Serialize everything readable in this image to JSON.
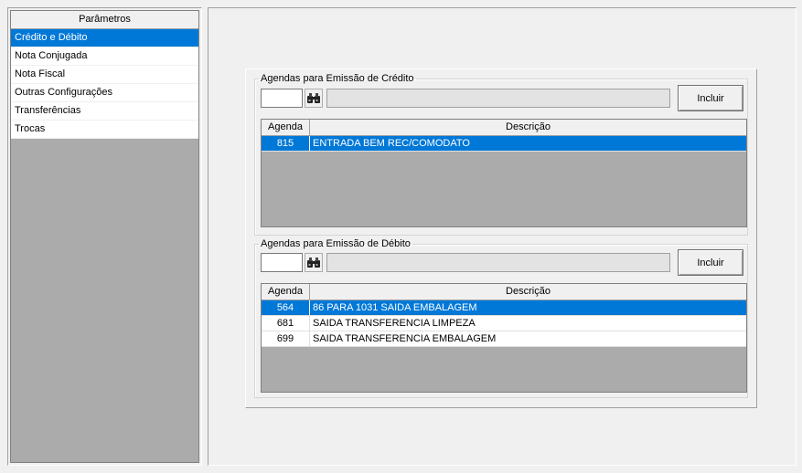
{
  "sidebar": {
    "header": "Parâmetros",
    "items": [
      {
        "label": "Crédito e Débito",
        "selected": true
      },
      {
        "label": "Nota Conjugada",
        "selected": false
      },
      {
        "label": "Nota Fiscal",
        "selected": false
      },
      {
        "label": "Outras Configurações",
        "selected": false
      },
      {
        "label": "Transferências",
        "selected": false
      },
      {
        "label": "Trocas",
        "selected": false
      }
    ]
  },
  "credit": {
    "legend": "Agendas para Emissão de Crédito",
    "code_value": "",
    "description_value": "",
    "include_label": "Incluir",
    "columns": {
      "agenda": "Agenda",
      "descricao": "Descrição"
    },
    "rows": [
      {
        "agenda": "815",
        "descricao": "ENTRADA BEM REC/COMODATO",
        "selected": true
      }
    ]
  },
  "debit": {
    "legend": "Agendas para Emissão de Débito",
    "code_value": "",
    "description_value": "",
    "include_label": "Incluir",
    "columns": {
      "agenda": "Agenda",
      "descricao": "Descrição"
    },
    "rows": [
      {
        "agenda": "564",
        "descricao": "86 PARA 1031 SAIDA EMBALAGEM",
        "selected": true
      },
      {
        "agenda": "681",
        "descricao": "SAIDA TRANSFERENCIA LIMPEZA",
        "selected": false
      },
      {
        "agenda": "699",
        "descricao": "SAIDA TRANSFERENCIA EMBALAGEM",
        "selected": false
      }
    ]
  },
  "icons": {
    "search": "binoculars-icon"
  },
  "colors": {
    "selection": "#0078d7",
    "grid_empty": "#ababab",
    "window_bg": "#f0f0f0"
  }
}
